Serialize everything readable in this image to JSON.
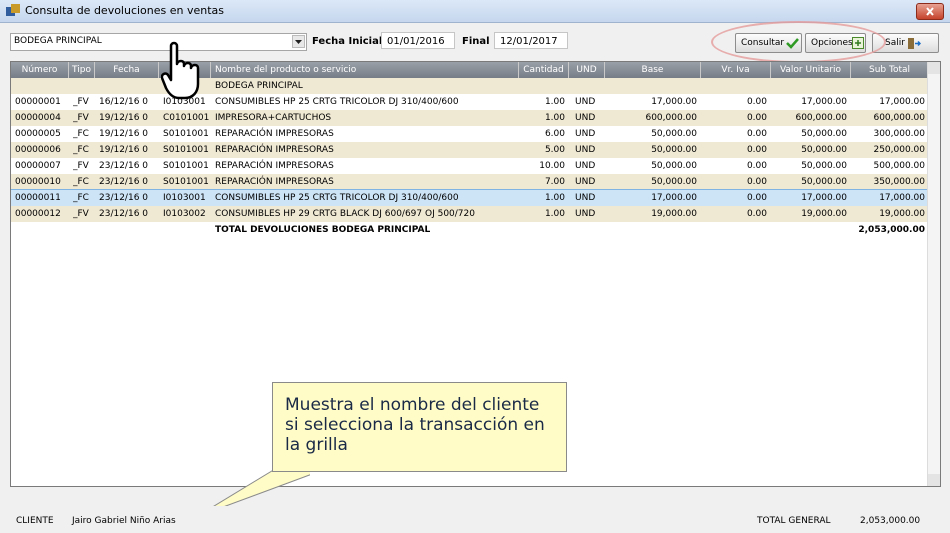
{
  "window": {
    "title": "Consulta de devoluciones en ventas"
  },
  "filters": {
    "warehouse": "BODEGA PRINCIPAL",
    "start_label": "Fecha Inicial",
    "start_date": "01/01/2016",
    "end_label": "Final",
    "end_date": "12/01/2017"
  },
  "buttons": {
    "consultar": "Consultar",
    "opciones": "Opciones",
    "salir": "Salir"
  },
  "grid": {
    "columns": [
      "Número",
      "Tipo",
      "Fecha",
      "",
      "Nombre del producto o servicio",
      "Cantidad",
      "UND",
      "Base",
      "Vr. Iva",
      "Valor Unitario",
      "Sub Total"
    ],
    "group_title": "BODEGA PRINCIPAL",
    "rows": [
      [
        "00000001",
        "_FV",
        "16/12/16 0",
        "I0103001",
        "CONSUMIBLES HP 25 CRTG TRICOLOR DJ 310/400/600",
        "1.00",
        "UND",
        "17,000.00",
        "0.00",
        "17,000.00",
        "17,000.00"
      ],
      [
        "00000004",
        "_FV",
        "19/12/16 0",
        "C0101001",
        "IMPRESORA+CARTUCHOS",
        "1.00",
        "UND",
        "600,000.00",
        "0.00",
        "600,000.00",
        "600,000.00"
      ],
      [
        "00000005",
        "_FC",
        "19/12/16 0",
        "S0101001",
        "REPARACIÓN IMPRESORAS",
        "6.00",
        "UND",
        "50,000.00",
        "0.00",
        "50,000.00",
        "300,000.00"
      ],
      [
        "00000006",
        "_FC",
        "19/12/16 0",
        "S0101001",
        "REPARACIÓN IMPRESORAS",
        "5.00",
        "UND",
        "50,000.00",
        "0.00",
        "50,000.00",
        "250,000.00"
      ],
      [
        "00000007",
        "_FV",
        "23/12/16 0",
        "S0101001",
        "REPARACIÓN IMPRESORAS",
        "10.00",
        "UND",
        "50,000.00",
        "0.00",
        "50,000.00",
        "500,000.00"
      ],
      [
        "00000010",
        "_FC",
        "23/12/16 0",
        "S0101001",
        "REPARACIÓN IMPRESORAS",
        "7.00",
        "UND",
        "50,000.00",
        "0.00",
        "50,000.00",
        "350,000.00"
      ],
      [
        "00000011",
        "_FC",
        "23/12/16 0",
        "I0103001",
        "CONSUMIBLES HP 25 CRTG TRICOLOR DJ 310/400/600",
        "1.00",
        "UND",
        "17,000.00",
        "0.00",
        "17,000.00",
        "17,000.00"
      ],
      [
        "00000012",
        "_FV",
        "23/12/16 0",
        "I0103002",
        "CONSUMIBLES HP 29 CRTG BLACK DJ 600/697 OJ 500/720",
        "1.00",
        "UND",
        "19,000.00",
        "0.00",
        "19,000.00",
        "19,000.00"
      ]
    ],
    "total_label": "TOTAL DEVOLUCIONES BODEGA PRINCIPAL",
    "total_value": "2,053,000.00"
  },
  "callout": {
    "text": "Muestra el nombre del cliente si selecciona la transacción en la grilla"
  },
  "status": {
    "client_label": "CLIENTE",
    "client_name": "Jairo Gabriel Niño Arias",
    "total_label": "TOTAL GENERAL",
    "total_value": "2,053,000.00"
  },
  "colors": {
    "row_alt": "#efe8d3",
    "row_selected": "#cde4f7",
    "header": "#8a9099",
    "callout_bg": "#fffcc8"
  },
  "icons": [
    "app-icon",
    "close-icon",
    "dropdown-arrow-icon",
    "checkmark-icon",
    "options-icon",
    "exit-icon",
    "hand-pointer-icon"
  ]
}
